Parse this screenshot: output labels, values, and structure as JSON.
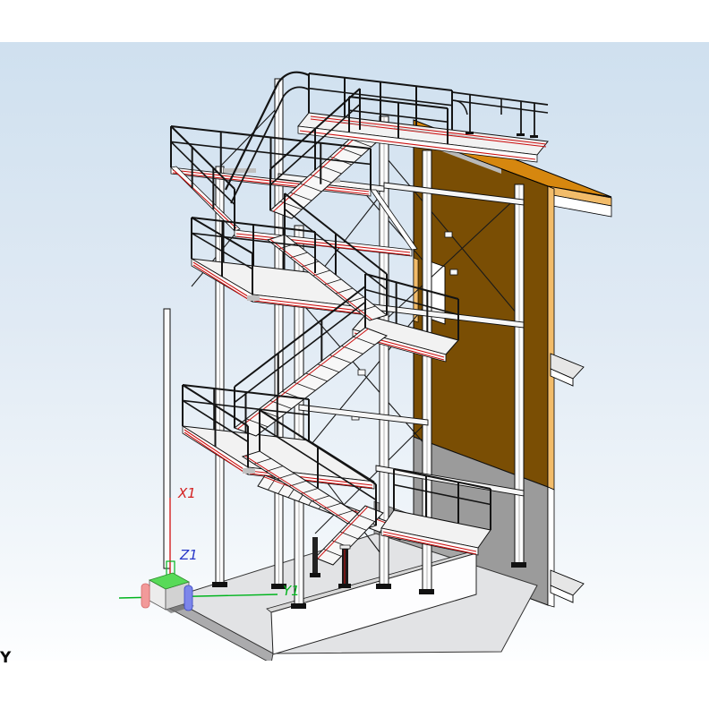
{
  "view": {
    "label": "Y"
  },
  "axes": {
    "x": {
      "label": "X1",
      "color": "#d42020"
    },
    "y": {
      "label": "Y1",
      "color": "#00b41e"
    },
    "z": {
      "label": "Z1",
      "color": "#2736c8"
    }
  },
  "colors": {
    "background_top": "#cfe0ef",
    "background_bottom": "#ffffff",
    "wall_face": "#7a4e04",
    "wall_roof": "#d6870f",
    "wall_edge": "#f2bc6a",
    "gray_wall": "#9b9b9b",
    "floor": "#e2e3e5",
    "steel_accent_red": "#cc1111",
    "cube_top": "#58da58",
    "cube_red_handle": "#f29a9a",
    "cube_blue_handle": "#7d86ea"
  }
}
